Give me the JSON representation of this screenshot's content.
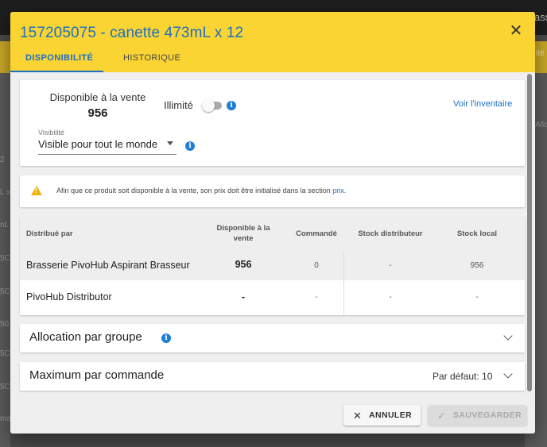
{
  "dialog": {
    "title": "157205075 - canette 473mL x 12",
    "close_icon": "close-icon",
    "tabs": [
      {
        "label": "DISPONIBILITÉ",
        "active": true
      },
      {
        "label": "HISTORIQUE",
        "active": false
      }
    ]
  },
  "availability": {
    "label": "Disponible à la vente",
    "value": "956",
    "unlimited_label": "Illimité",
    "unlimited_on": false,
    "inventory_link": "Voir l'inventaire",
    "visibility_label": "Visibilité",
    "visibility_value": "Visible pour tout le monde"
  },
  "warning": {
    "text": "Afin que ce produit soit disponible à la vente, son prix doit être initialisé dans la section",
    "link": "prix",
    "end": "."
  },
  "table": {
    "headers": [
      "Distribué par",
      "Disponible à la vente",
      "Commandé",
      "Stock distributeur",
      "Stock local"
    ],
    "rows": [
      {
        "name": "Brasserie PivoHub Aspirant Brasseur",
        "available": "956",
        "ordered": "0",
        "dist_stock": "-",
        "local_stock": "956"
      },
      {
        "name": "PivoHub Distributor",
        "available": "-",
        "ordered": "-",
        "dist_stock": "-",
        "local_stock": "-"
      }
    ]
  },
  "sections": {
    "allocation_title": "Allocation par groupe",
    "max_title": "Maximum par commande",
    "max_default": "Par défaut: 10"
  },
  "footer": {
    "cancel_label": "ANNULER",
    "save_label": "SAUVEGARDER"
  },
  "background": {
    "fragments": [
      "ass",
      "ité",
      "Allo",
      "2",
      "L x",
      "nL x",
      "5C",
      "5C",
      "50",
      "5C",
      "5C",
      "ma"
    ]
  },
  "colors": {
    "header": "#f9d433",
    "accent": "#1c6fc4",
    "warning": "#f2b308"
  }
}
